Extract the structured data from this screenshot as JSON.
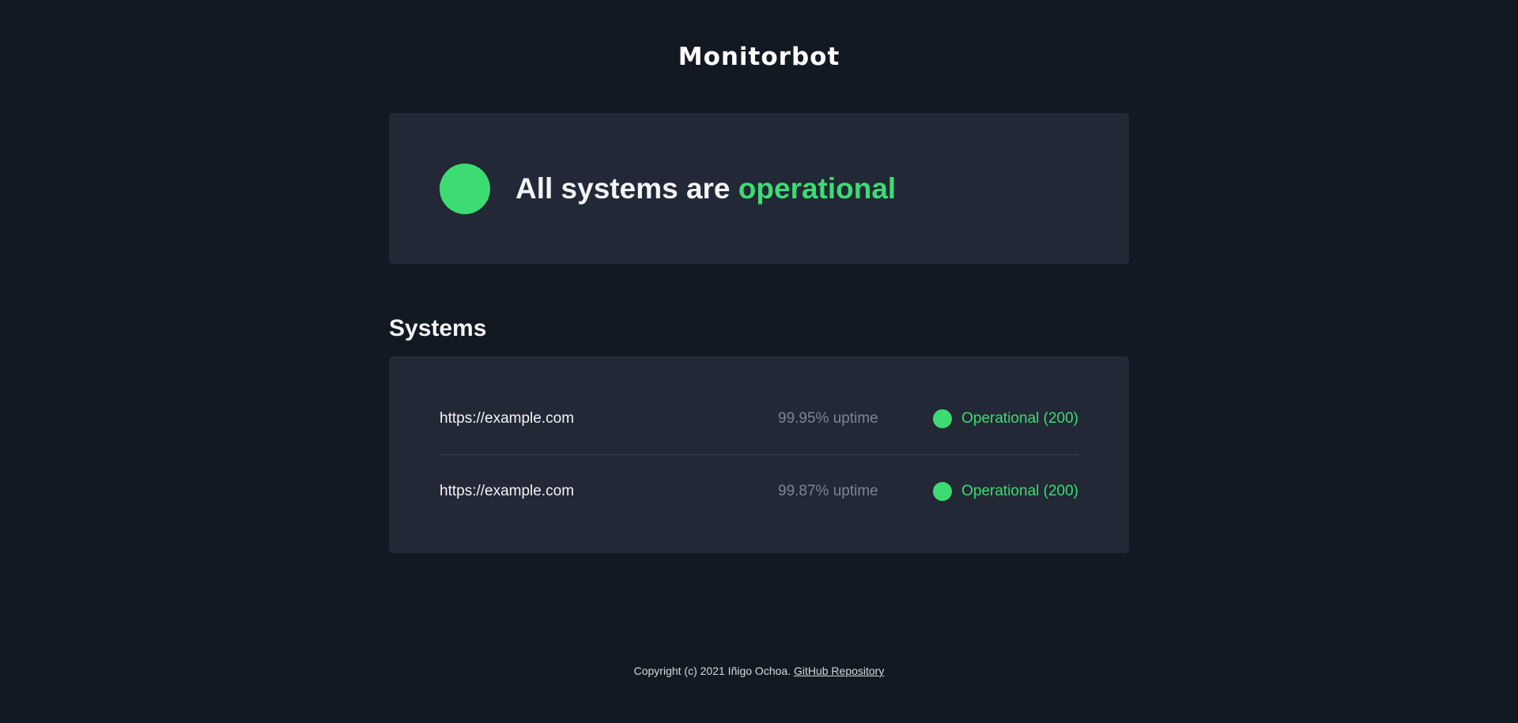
{
  "header": {
    "logo_text": "Monitorbot"
  },
  "overall": {
    "prefix": "All systems are",
    "status_word": "operational",
    "status_color": "#3ddc73"
  },
  "systems": {
    "heading": "Systems",
    "items": [
      {
        "url": "https://example.com",
        "uptime": "99.95% uptime",
        "status": "Operational (200)",
        "status_color": "#3ddc73"
      },
      {
        "url": "https://example.com",
        "uptime": "99.87% uptime",
        "status": "Operational (200)",
        "status_color": "#3ddc73"
      }
    ]
  },
  "footer": {
    "copyright": "Copyright (c) 2021 Iñigo Ochoa.",
    "link_label": "GitHub Repository"
  },
  "colors": {
    "background": "#131923",
    "card": "#222836",
    "accent_green": "#3ddc73",
    "muted_text": "#7e8490"
  }
}
